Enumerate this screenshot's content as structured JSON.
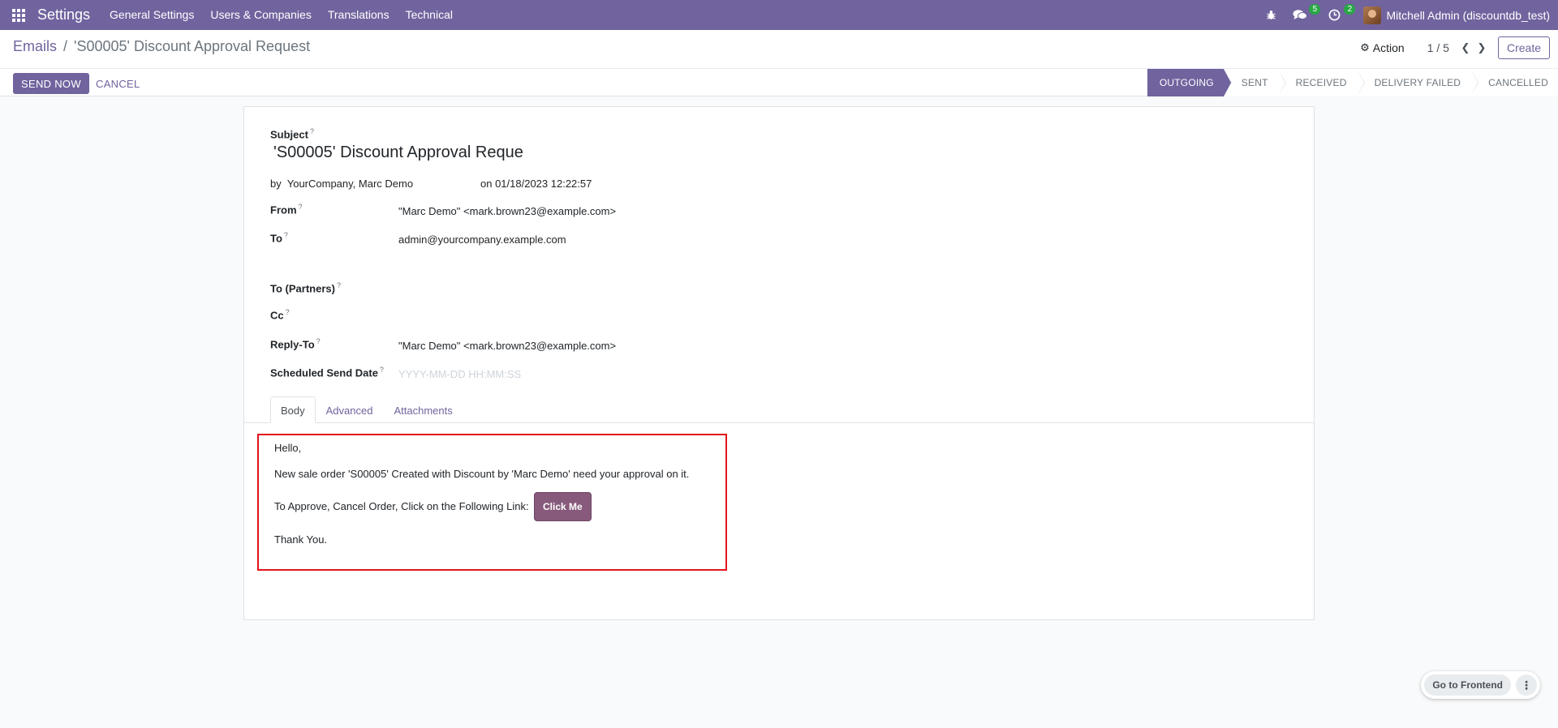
{
  "navbar": {
    "app_name": "Settings",
    "menu": [
      "General Settings",
      "Users & Companies",
      "Translations",
      "Technical"
    ],
    "messages_count": "5",
    "activities_count": "2",
    "user": "Mitchell Admin (discountdb_test)"
  },
  "breadcrumb": {
    "parent": "Emails",
    "separator": "/",
    "current": "'S00005' Discount Approval Request"
  },
  "control": {
    "action_label": "Action",
    "pager": "1 / 5",
    "create_label": "Create",
    "send_now_label": "SEND NOW",
    "cancel_label": "CANCEL"
  },
  "status": {
    "steps": [
      "OUTGOING",
      "SENT",
      "RECEIVED",
      "DELIVERY FAILED",
      "CANCELLED"
    ],
    "active": "OUTGOING"
  },
  "form": {
    "subject_label": "Subject",
    "subject_value": "'S00005' Discount Approval Reque",
    "by_prefix": "by",
    "by_value": "YourCompany, Marc Demo",
    "on_text": "on 01/18/2023 12:22:57",
    "help_mark": "?",
    "from_label": "From",
    "from_value": "\"Marc Demo\" <mark.brown23@example.com>",
    "to_label": "To",
    "to_value": "admin@yourcompany.example.com",
    "to_partners_label": "To (Partners)",
    "cc_label": "Cc",
    "reply_to_label": "Reply-To",
    "reply_to_value": "\"Marc Demo\" <mark.brown23@example.com>",
    "scheduled_label": "Scheduled Send Date",
    "scheduled_placeholder": "YYYY-MM-DD HH:MM:SS"
  },
  "tabs": [
    "Body",
    "Advanced",
    "Attachments"
  ],
  "body": {
    "greeting": "Hello,",
    "line1": "New sale order 'S00005' Created with Discount by 'Marc Demo' need your approval on it.",
    "line2": "To Approve, Cancel Order, Click on the Following Link:",
    "button_label": "Click Me",
    "closing": "Thank You."
  },
  "frontend": {
    "label": "Go to Frontend"
  },
  "colors": {
    "brand": "#71639e",
    "button": "#875a7b",
    "highlight_border": "#e2141c"
  }
}
